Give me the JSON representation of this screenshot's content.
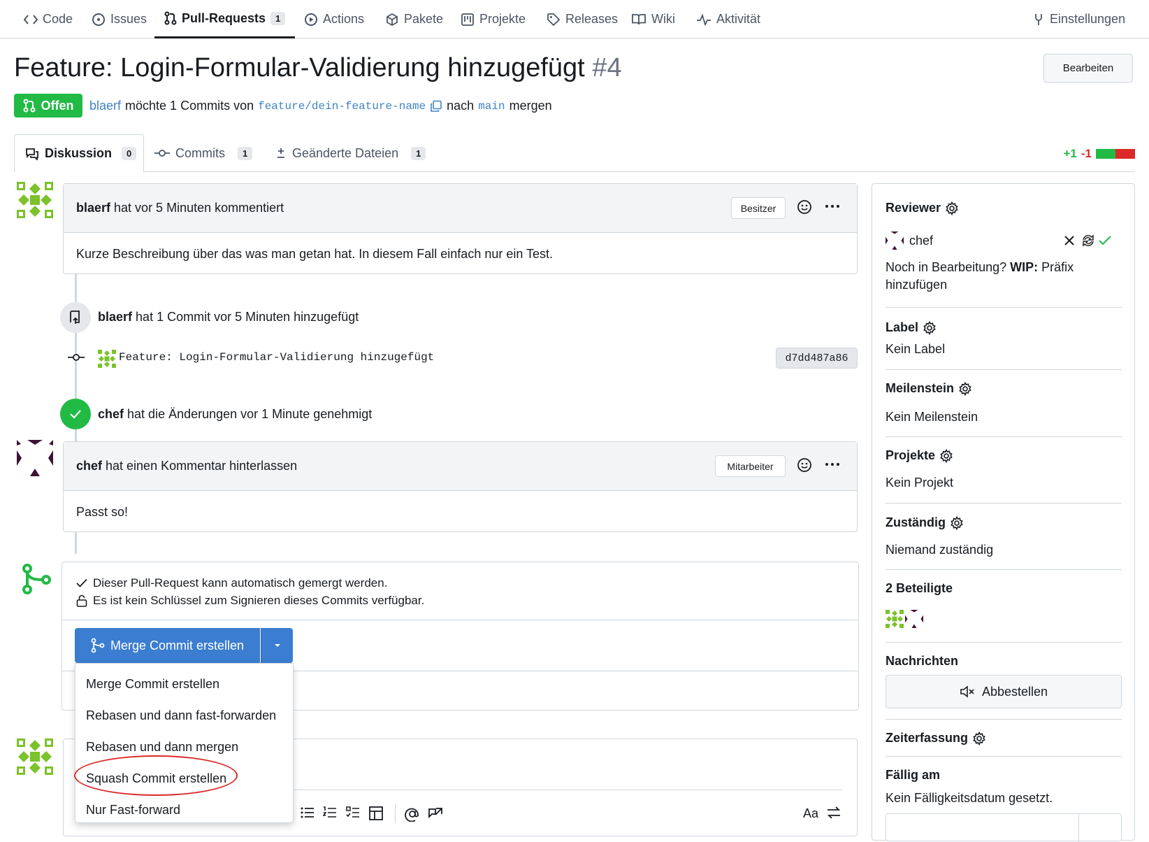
{
  "nav": {
    "code": "Code",
    "issues": "Issues",
    "pulls": "Pull-Requests",
    "pulls_count": "1",
    "actions": "Actions",
    "packages": "Pakete",
    "projects": "Projekte",
    "releases": "Releases",
    "wiki": "Wiki",
    "activity": "Aktivität",
    "settings": "Einstellungen"
  },
  "pr": {
    "title": "Feature: Login-Formular-Validierung hinzugefügt",
    "number": "#4",
    "edit_label": "Bearbeiten",
    "state": "Offen",
    "author": "blaerf",
    "subtitle_mid": "möchte 1 Commits von",
    "head_branch": "feature/dein-feature-name",
    "subtitle_into": "nach",
    "base_branch": "main",
    "subtitle_end": "mergen"
  },
  "tabs": {
    "discussion": "Diskussion",
    "discussion_count": "0",
    "commits": "Commits",
    "commits_count": "1",
    "files": "Geänderte Dateien",
    "files_count": "1",
    "additions": "+1",
    "deletions": "-1"
  },
  "timeline": {
    "c1_author": "blaerf",
    "c1_meta": "hat vor 5 Minuten kommentiert",
    "c1_role": "Besitzer",
    "c1_body": "Kurze Beschreibung über das was man getan hat. In diesem Fall einfach nur ein Test.",
    "push_author": "blaerf",
    "push_text": "hat 1 Commit vor 5 Minuten hinzugefügt",
    "commit_msg": "Feature: Login-Formular-Validierung hinzugefügt",
    "commit_sha": "d7dd487a86",
    "approve_author": "chef",
    "approve_text": "hat die Änderungen vor 1 Minute genehmigt",
    "c2_author": "chef",
    "c2_meta": "hat einen Kommentar hinterlassen",
    "c2_role": "Mitarbeiter",
    "c2_body": "Passt so!"
  },
  "merge": {
    "status_ok": "Dieser Pull-Request kann automatisch gemergt werden.",
    "status_sign": "Es ist kein Schlüssel zum Signieren dieses Commits verfügbar.",
    "button": "Merge Commit erstellen",
    "options": [
      "Merge Commit erstellen",
      "Rebasen und dann fast-forwarden",
      "Rebasen und dann mergen",
      "Squash Commit erstellen",
      "Nur Fast-forward"
    ],
    "toolbar_font": "Aa"
  },
  "sidebar": {
    "reviewer_title": "Reviewer",
    "reviewer_name": "chef",
    "wip_text_a": "Noch in Bearbeitung?",
    "wip_bold": "WIP:",
    "wip_text_b": "Präfix hinzufügen",
    "label_title": "Label",
    "label_value": "Kein Label",
    "milestone_title": "Meilenstein",
    "milestone_value": "Kein Meilenstein",
    "projects_title": "Projekte",
    "projects_value": "Kein Projekt",
    "assignee_title": "Zuständig",
    "assignee_value": "Niemand zuständig",
    "participants_title": "2 Beteiligte",
    "notifications_title": "Nachrichten",
    "unsubscribe": "Abbestellen",
    "time_title": "Zeiterfassung",
    "due_title": "Fällig am",
    "due_value": "Kein Fälligkeitsdatum gesetzt."
  },
  "colors": {
    "open_green": "#21ba45",
    "primary_blue": "#3b7dd0",
    "link_blue": "#4183c4",
    "delete_red": "#db2828",
    "avatar_green": "#7cc22b",
    "avatar_purple": "#3d1436"
  }
}
